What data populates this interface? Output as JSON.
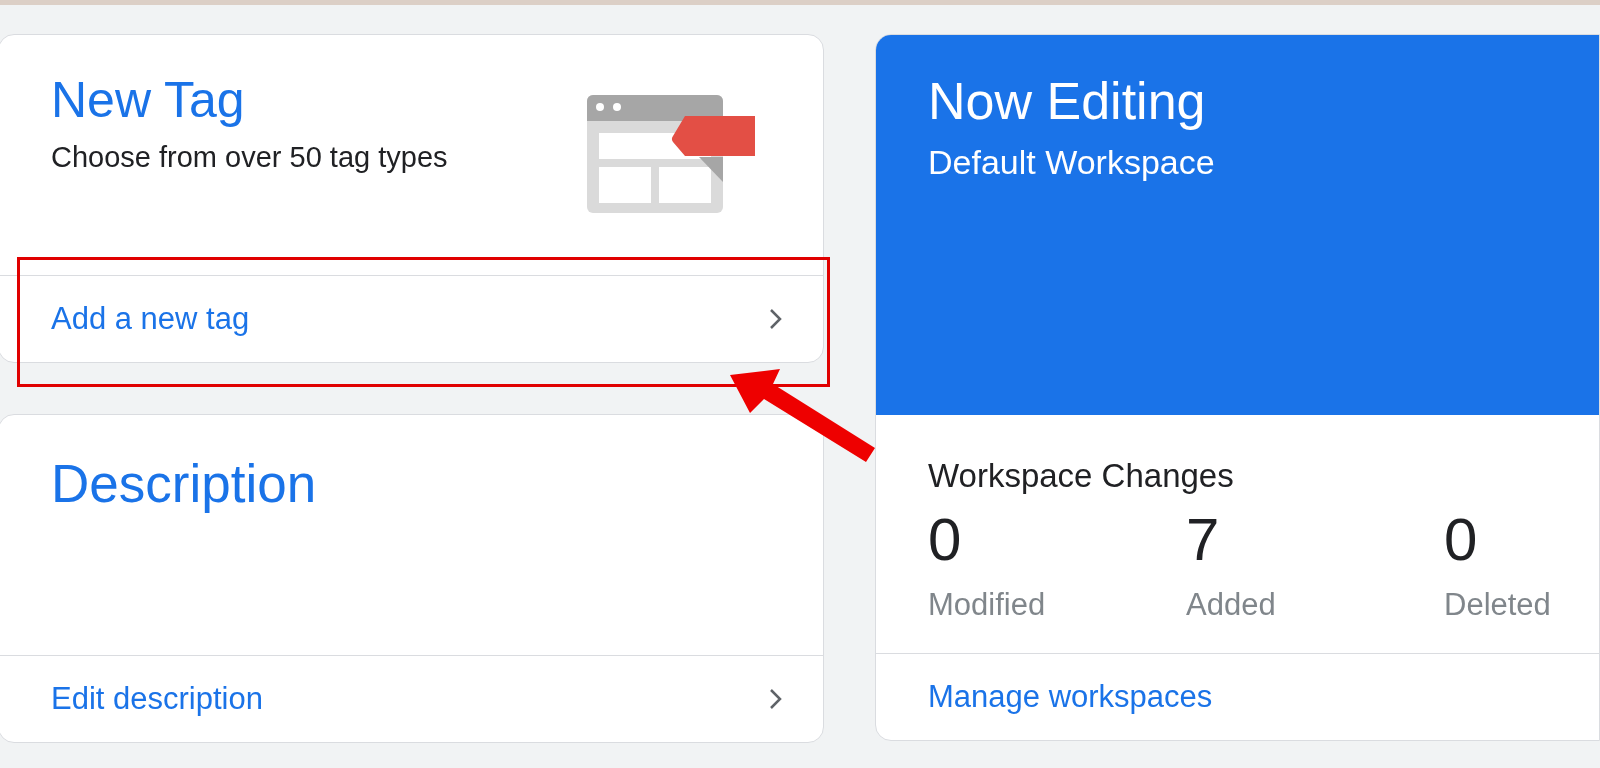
{
  "new_tag_card": {
    "title": "New Tag",
    "subtitle": "Choose from over 50 tag types",
    "action": "Add a new tag"
  },
  "description_card": {
    "title": "Description",
    "action": "Edit description"
  },
  "workspace_card": {
    "header_title": "Now Editing",
    "workspace_name": "Default Workspace",
    "changes_title": "Workspace Changes",
    "stats": [
      {
        "value": "0",
        "label": "Modified"
      },
      {
        "value": "7",
        "label": "Added"
      },
      {
        "value": "0",
        "label": "Deleted"
      }
    ],
    "action": "Manage workspaces"
  }
}
